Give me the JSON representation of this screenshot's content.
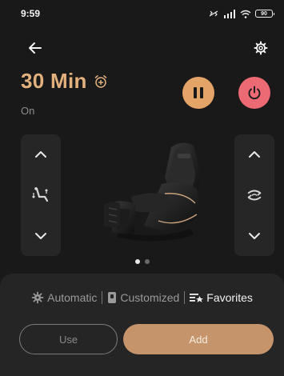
{
  "status_bar": {
    "time": "9:59",
    "battery": "90"
  },
  "header": {
    "back_icon": "arrow-left-icon",
    "settings_icon": "gear-icon"
  },
  "session": {
    "timer": "30 Min",
    "status": "On",
    "timer_icon": "alarm-plus-icon"
  },
  "controls": {
    "pause_icon": "pause-icon",
    "power_icon": "power-icon"
  },
  "left_panel": {
    "up_icon": "chevron-up-icon",
    "mode_icon": "recline-adjust-icon",
    "down_icon": "chevron-down-icon"
  },
  "right_panel": {
    "up_icon": "chevron-up-icon",
    "mode_icon": "rotate-arrows-icon",
    "down_icon": "chevron-down-icon"
  },
  "carousel": {
    "pages": 2,
    "active": 1
  },
  "modes": [
    {
      "label": "Automatic",
      "icon": "gear-icon",
      "active": false
    },
    {
      "label": "Customized",
      "icon": "phone-card-icon",
      "active": false
    },
    {
      "label": "Favorites",
      "icon": "list-star-icon",
      "active": true
    }
  ],
  "actions": {
    "use": "Use",
    "add": "Add"
  },
  "colors": {
    "accent": "#e3b17e",
    "pause": "#e5a467",
    "power": "#ec6a73",
    "add_button": "#c6946a",
    "background": "#191919"
  }
}
